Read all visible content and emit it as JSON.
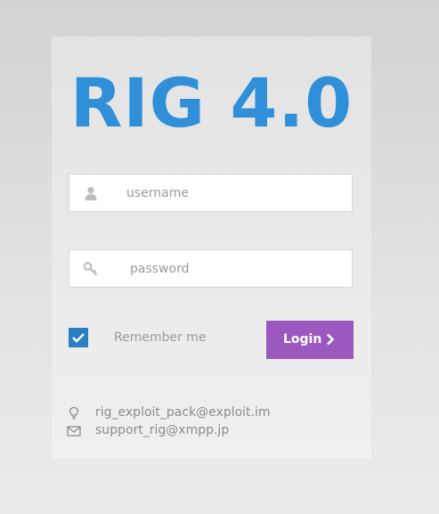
{
  "logo": {
    "text": "RIG 4.0"
  },
  "form": {
    "username": {
      "placeholder": "username",
      "value": "",
      "icon": "user-icon"
    },
    "password": {
      "placeholder": "password",
      "value": "",
      "icon": "key-icon"
    },
    "remember": {
      "label": "Remember me",
      "checked": true
    },
    "login": {
      "label": "Login",
      "icon": "chevron-right-icon"
    }
  },
  "contacts": [
    {
      "icon": "lightbulb-icon",
      "text": "rig_exploit_pack@exploit.im"
    },
    {
      "icon": "envelope-icon",
      "text": "support_rig@xmpp.jp"
    }
  ],
  "colors": {
    "logo": "#2f8fd8",
    "checkbox": "#2b7fc1",
    "login_button": "#9b59c0",
    "muted_text": "#9a9a9a"
  }
}
